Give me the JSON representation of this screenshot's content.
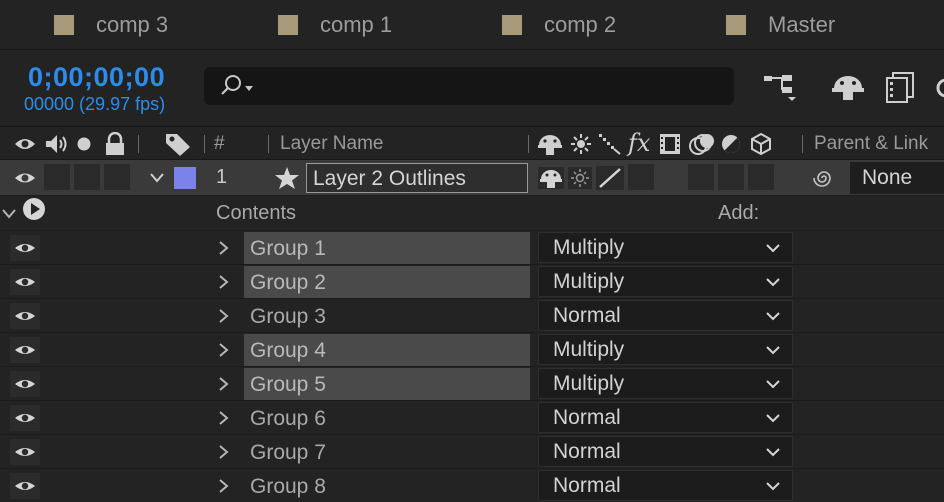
{
  "tabs": [
    {
      "label": "comp 3",
      "swatch": "#a89a7a"
    },
    {
      "label": "comp 1",
      "swatch": "#a89a7a"
    },
    {
      "label": "comp 2",
      "swatch": "#a89a7a"
    },
    {
      "label": "Master",
      "swatch": "#a89a7a"
    }
  ],
  "timecode": {
    "value": "0;00;00;00",
    "frames": "00000 (29.97 fps)"
  },
  "search": {
    "placeholder": ""
  },
  "columns": {
    "number": "#",
    "layer_name": "Layer Name",
    "parent_link": "Parent & Link"
  },
  "layer": {
    "number": "1",
    "name": "Layer 2 Outlines",
    "label_color": "#7b82e8",
    "parent": "None"
  },
  "contents": {
    "label": "Contents",
    "add_label": "Add:"
  },
  "groups": [
    {
      "name": "Group 1",
      "blend": "Multiply",
      "highlighted": true
    },
    {
      "name": "Group 2",
      "blend": "Multiply",
      "highlighted": true
    },
    {
      "name": "Group 3",
      "blend": "Normal",
      "highlighted": false
    },
    {
      "name": "Group 4",
      "blend": "Multiply",
      "highlighted": true
    },
    {
      "name": "Group 5",
      "blend": "Multiply",
      "highlighted": true
    },
    {
      "name": "Group 6",
      "blend": "Normal",
      "highlighted": false
    },
    {
      "name": "Group 7",
      "blend": "Normal",
      "highlighted": false
    },
    {
      "name": "Group 8",
      "blend": "Normal",
      "highlighted": false
    }
  ],
  "colors": {
    "accent": "#2d8ceb",
    "background": "#232323",
    "row_selected": "#3a3a3a"
  }
}
